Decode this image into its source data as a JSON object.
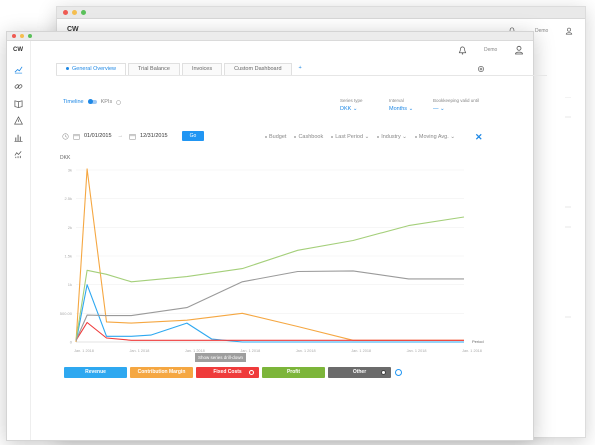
{
  "app": {
    "logo": "CW",
    "user_name": "Demo"
  },
  "tabs": [
    {
      "label": "General Overview",
      "active": true
    },
    {
      "label": "Trial Balance",
      "active": false
    },
    {
      "label": "Invoices",
      "active": false
    },
    {
      "label": "Custom Dashboard",
      "active": false
    },
    {
      "label": "+",
      "active": false
    }
  ],
  "toggle": {
    "timeline_label": "Timeline",
    "kpis_label": "KPIs"
  },
  "options": {
    "series_type": {
      "label": "Series type",
      "value": "DKK"
    },
    "interval": {
      "label": "Interval",
      "value": "Months"
    },
    "bookkeeping": {
      "label": "Bookkeeping valid until",
      "value": "—"
    }
  },
  "dates": {
    "from": "01/01/2015",
    "to": "12/31/2015",
    "go_label": "Go"
  },
  "filters": [
    "Budget",
    "Cashbook",
    "Last Period",
    "Industry",
    "Moving Avg."
  ],
  "tooltip": "Show series drill-down",
  "legend": [
    {
      "label": "Revenue",
      "color": "#2ea8f0",
      "has_circle": false,
      "circle_filled": false
    },
    {
      "label": "Contribution Margin",
      "color": "#f5a742",
      "has_circle": false,
      "circle_filled": false
    },
    {
      "label": "Fixed Costs",
      "color": "#ef3b3b",
      "has_circle": true,
      "circle_filled": false
    },
    {
      "label": "Profit",
      "color": "#7cb53a",
      "has_circle": false,
      "circle_filled": false
    },
    {
      "label": "Other",
      "color": "#6b6b6b",
      "has_circle": true,
      "circle_filled": true
    }
  ],
  "chart_data": {
    "type": "line",
    "ylabel": "DKK",
    "xlabel": "Period",
    "y_ticks": [
      "0",
      "500.00",
      "1k",
      "1.5k",
      "2k",
      "2.5k",
      "3k"
    ],
    "ylim": [
      0,
      3000
    ],
    "x": [
      "Jan. 1 2018",
      "Jan. 1 2018",
      "Jan. 1 2018",
      "Jan. 1 2018",
      "Jan. 1 2018",
      "Jan. 1 2018",
      "Jan. 1 2018",
      "Jan. 1 2018"
    ],
    "series": [
      {
        "name": "Revenue",
        "color": "#2ea8f0",
        "points": [
          [
            0,
            0
          ],
          [
            0.2,
            1000
          ],
          [
            0.55,
            100
          ],
          [
            1.0,
            100
          ],
          [
            1.35,
            120
          ],
          [
            2.0,
            330
          ],
          [
            2.45,
            50
          ],
          [
            3,
            0
          ],
          [
            4,
            0
          ],
          [
            5,
            0
          ],
          [
            6,
            0
          ],
          [
            7,
            0
          ]
        ]
      },
      {
        "name": "Contribution Margin",
        "color": "#f5a742",
        "points": [
          [
            0,
            0
          ],
          [
            0.2,
            3020
          ],
          [
            0.55,
            350
          ],
          [
            1.0,
            330
          ],
          [
            2,
            380
          ],
          [
            3,
            500
          ],
          [
            4,
            270
          ],
          [
            5,
            30
          ],
          [
            6,
            30
          ],
          [
            7,
            30
          ]
        ]
      },
      {
        "name": "Fixed Costs",
        "color": "#ef3b3b",
        "points": [
          [
            0,
            30
          ],
          [
            0.2,
            340
          ],
          [
            0.55,
            70
          ],
          [
            1,
            30
          ],
          [
            2,
            30
          ],
          [
            3,
            30
          ],
          [
            4,
            30
          ],
          [
            5,
            30
          ],
          [
            6,
            30
          ],
          [
            7,
            30
          ]
        ]
      },
      {
        "name": "Profit",
        "color": "#a4cf7a",
        "points": [
          [
            0,
            30
          ],
          [
            0.2,
            1250
          ],
          [
            0.55,
            1180
          ],
          [
            1,
            1050
          ],
          [
            2,
            1140
          ],
          [
            3,
            1280
          ],
          [
            4,
            1600
          ],
          [
            5,
            1770
          ],
          [
            6,
            2030
          ],
          [
            7,
            2180
          ]
        ]
      },
      {
        "name": "Other",
        "color": "#9a9a9a",
        "points": [
          [
            0,
            30
          ],
          [
            0.2,
            470
          ],
          [
            0.55,
            460
          ],
          [
            1,
            460
          ],
          [
            2,
            600
          ],
          [
            3,
            1050
          ],
          [
            4,
            1230
          ],
          [
            5,
            1240
          ],
          [
            6,
            1100
          ],
          [
            7,
            1100
          ]
        ]
      }
    ]
  }
}
